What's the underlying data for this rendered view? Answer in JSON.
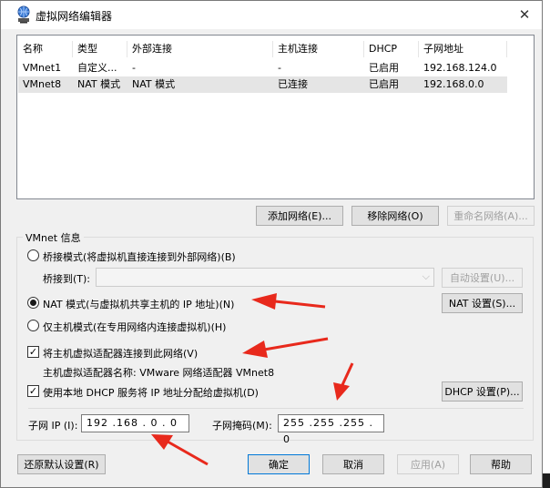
{
  "window": {
    "title": "虚拟网络编辑器",
    "close_glyph": "✕"
  },
  "table": {
    "headers": [
      "名称",
      "类型",
      "外部连接",
      "主机连接",
      "DHCP",
      "子网地址"
    ],
    "rows": [
      [
        "VMnet1",
        "自定义...",
        "-",
        "-",
        "已启用",
        "192.168.124.0"
      ],
      [
        "VMnet8",
        "NAT 模式",
        "NAT 模式",
        "已连接",
        "已启用",
        "192.168.0.0"
      ]
    ]
  },
  "table_buttons": {
    "add": "添加网络(E)...",
    "remove": "移除网络(O)",
    "rename": "重命名网络(A)..."
  },
  "vmnet_info": {
    "title": "VMnet 信息",
    "bridged_label": "桥接模式(将虚拟机直接连接到外部网络)(B)",
    "bridge_to_label": "桥接到(T):",
    "auto_settings": "自动设置(U)...",
    "nat_label": "NAT 模式(与虚拟机共享主机的 IP 地址)(N)",
    "nat_settings": "NAT 设置(S)...",
    "hostonly_label": "仅主机模式(在专用网络内连接虚拟机)(H)",
    "connect_adapter_label": "将主机虚拟适配器连接到此网络(V)",
    "adapter_name_text": "主机虚拟适配器名称: VMware 网络适配器 VMnet8",
    "dhcp_label": "使用本地 DHCP 服务将 IP 地址分配给虚拟机(D)",
    "dhcp_settings": "DHCP 设置(P)...",
    "check_glyph": "✓",
    "subnet_ip_label": "子网 IP (I):",
    "subnet_ip_value": "192 .168 . 0 . 0",
    "subnet_mask_label": "子网掩码(M):",
    "subnet_mask_value": "255 .255 .255 . 0"
  },
  "bottom_buttons": {
    "restore": "还原默认设置(R)",
    "ok": "确定",
    "cancel": "取消",
    "apply": "应用(A)",
    "help": "帮助"
  },
  "colors": {
    "annotation_arrow": "#e8291c",
    "accent": "#0078d7"
  }
}
